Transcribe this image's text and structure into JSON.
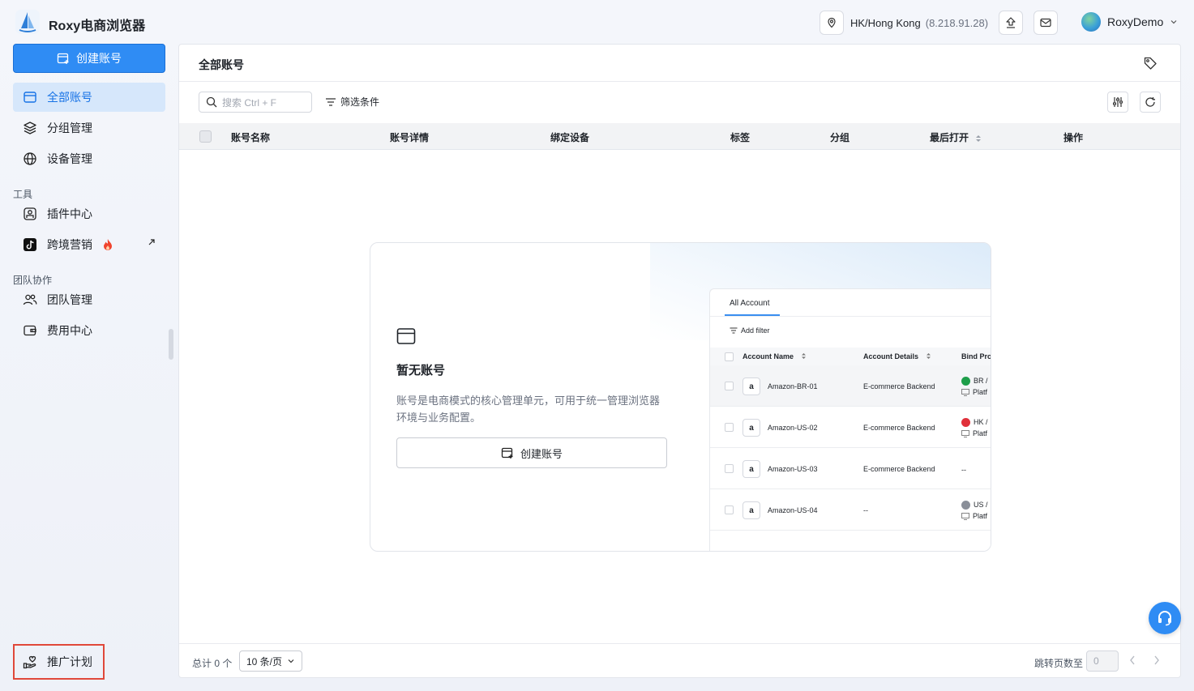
{
  "app": {
    "brand": "Roxy电商浏览器"
  },
  "topbar": {
    "location": "HK/Hong Kong",
    "ip": "(8.218.91.28)",
    "username": "RoxyDemo",
    "icons": [
      "location-pin-icon",
      "upload-icon",
      "mail-icon",
      "chevron-down-icon"
    ]
  },
  "sidebar": {
    "create_label": "创建账号",
    "items": [
      {
        "label": "全部账号",
        "icon": "window-icon",
        "active": true
      },
      {
        "label": "分组管理",
        "icon": "layers-icon",
        "active": false
      },
      {
        "label": "设备管理",
        "icon": "globe-icon",
        "active": false
      }
    ],
    "tools_section": "工具",
    "tools": [
      {
        "label": "插件中心",
        "icon": "plugin-icon"
      },
      {
        "label": "跨境营销",
        "icon": "tiktok-icon",
        "badge": "fire-icon",
        "external": true
      }
    ],
    "team_section": "团队协作",
    "team": [
      {
        "label": "团队管理",
        "icon": "users-icon"
      },
      {
        "label": "费用中心",
        "icon": "wallet-icon"
      }
    ],
    "promo_label": "推广计划"
  },
  "main": {
    "title": "全部账号",
    "search_placeholder": "搜索 Ctrl + F",
    "filter_label": "筛选条件",
    "columns": [
      "账号名称",
      "账号详情",
      "绑定设备",
      "标签",
      "分组",
      "最后打开",
      "操作"
    ]
  },
  "empty": {
    "title": "暂无账号",
    "description": "账号是电商模式的核心管理单元，可用于统一管理浏览器环境与业务配置。",
    "button_label": "创建账号"
  },
  "mini_preview": {
    "tab": "All Account",
    "filter": "Add filter",
    "headers": [
      "Account Name",
      "Account Details",
      "Bind Pro"
    ],
    "rows": [
      {
        "name": "Amazon-BR-01",
        "details": "E-commerce Backend",
        "bind_line1": "BR /",
        "bind_line2": "Platf",
        "flag_color": "#1e9e4a"
      },
      {
        "name": "Amazon-US-02",
        "details": "E-commerce Backend",
        "bind_line1": "HK /",
        "bind_line2": "Platf",
        "flag_color": "#e0303a"
      },
      {
        "name": "Amazon-US-03",
        "details": "E-commerce Backend",
        "bind_line1": "--",
        "bind_line2": "",
        "flag_color": ""
      },
      {
        "name": "Amazon-US-04",
        "details": "--",
        "bind_line1": "US /",
        "bind_line2": "Platf",
        "flag_color": "#8a8f99"
      }
    ],
    "amazon_glyph": "a"
  },
  "footer": {
    "total": "总计 0 个",
    "page_size": "10 条/页",
    "jump_label": "跳转页数至",
    "jump_value": "0"
  },
  "colors": {
    "accent": "#2f8cf4",
    "active_bg": "#d6e7fb",
    "promo_border": "#e0483a"
  }
}
